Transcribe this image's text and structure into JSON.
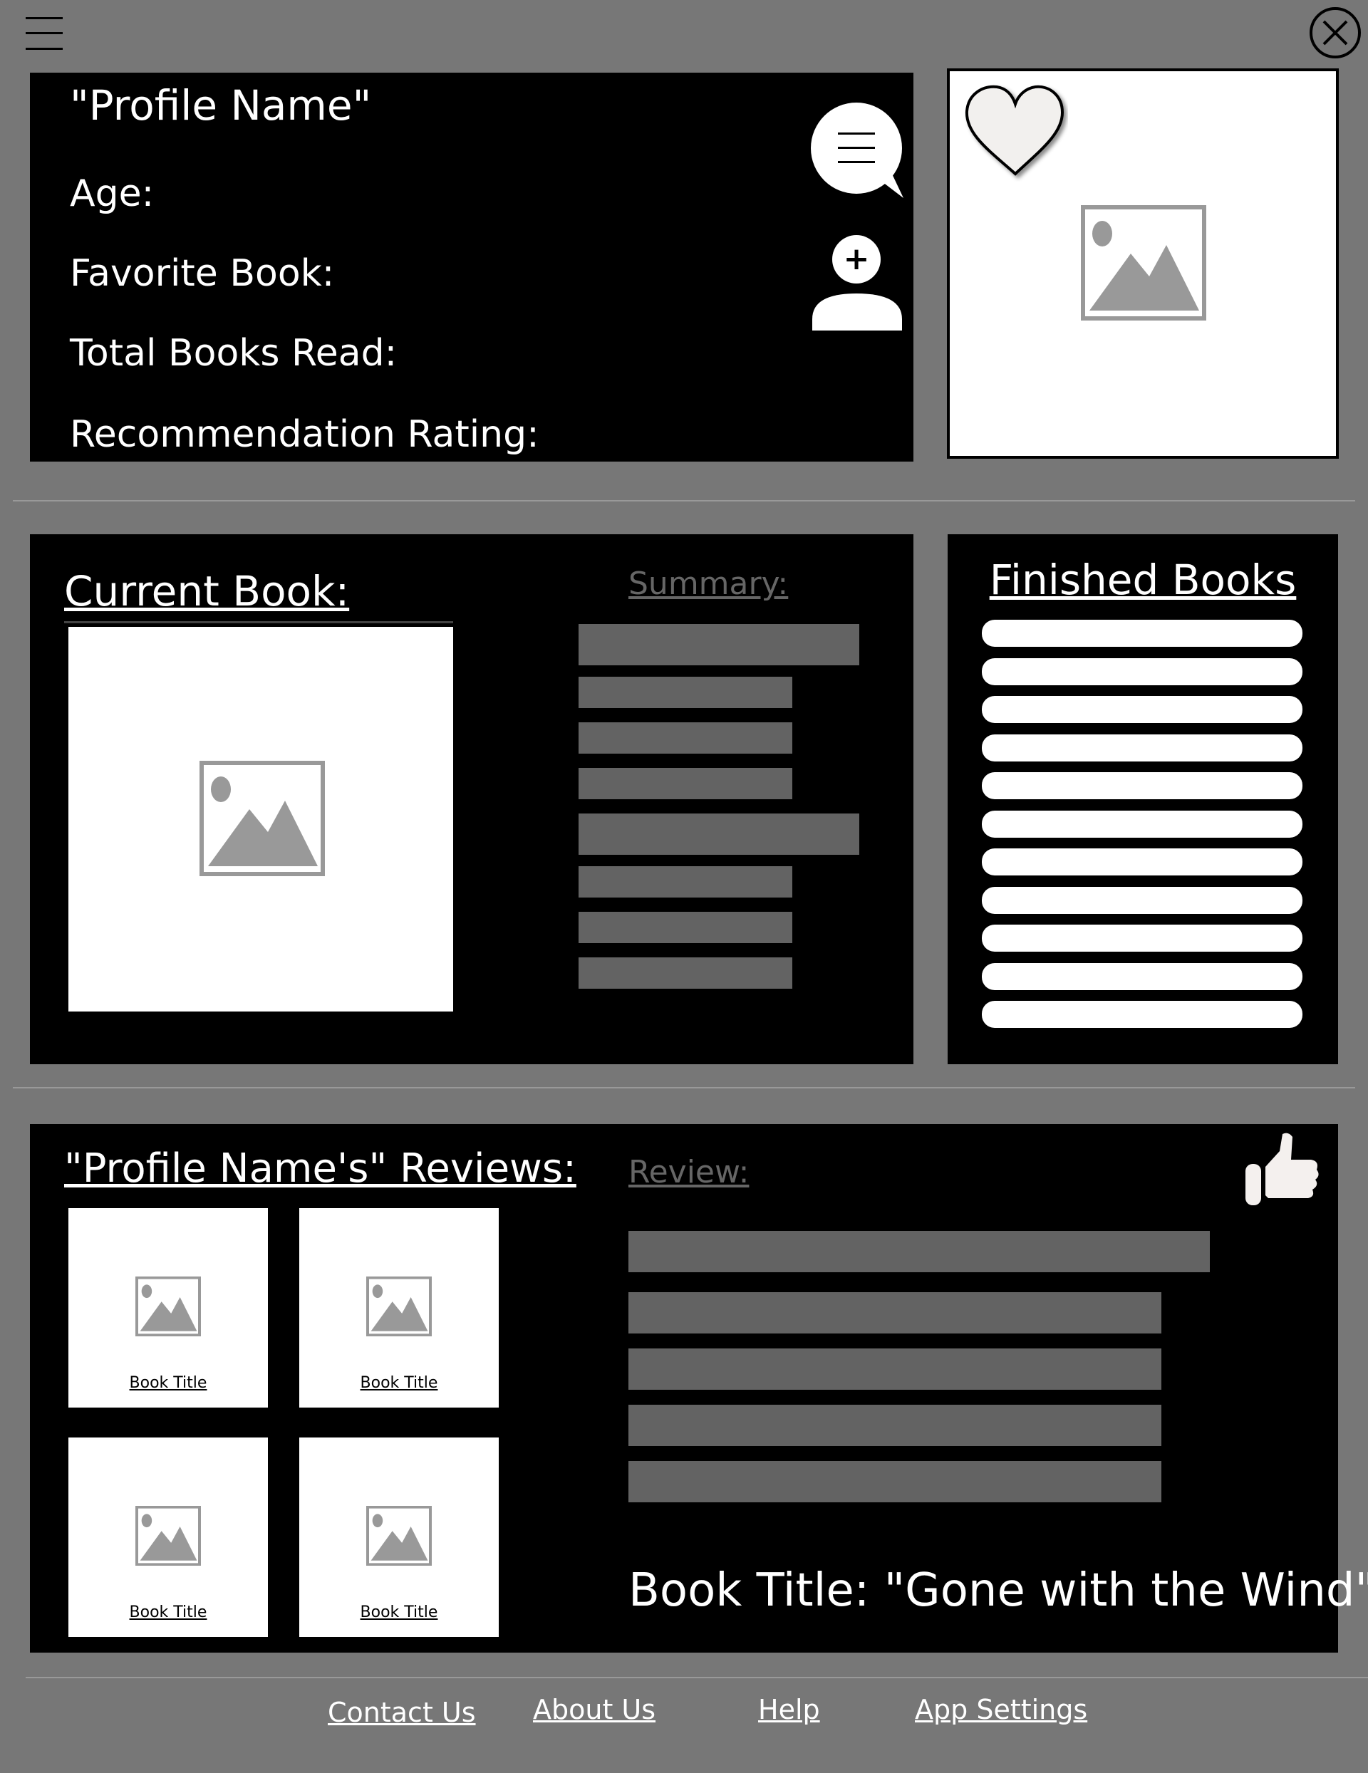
{
  "icons": {
    "menu": "hamburger-menu-icon",
    "close": "close-circle-icon",
    "chat": "chat-bubble-icon",
    "add_friend": "add-user-icon",
    "favorite": "heart-icon",
    "like": "thumbs-up-icon",
    "image": "image-placeholder-icon"
  },
  "profile": {
    "name": "\"Profile Name\"",
    "age_label": "Age:",
    "favorite_book_label": "Favorite Book:",
    "total_books_label": "Total Books Read:",
    "recommendation_label": "Recommendation Rating:"
  },
  "current": {
    "heading": "Current Book:",
    "summary_label": "Summary:"
  },
  "finished": {
    "heading": "Finished Books",
    "count": 11
  },
  "reviews": {
    "heading": "\"Profile Name's\" Reviews:",
    "review_label": "Review:",
    "tiles": [
      "Book Title",
      "Book Title",
      "Book Title",
      "Book Title"
    ],
    "book_title": "Book Title: \"Gone with the Wind\""
  },
  "footer": {
    "contact": "Contact Us",
    "about": "About Us",
    "help": "Help",
    "settings": "App Settings"
  },
  "colors": {
    "background": "#777777",
    "panel": "#000000",
    "placeholder_bar": "#636363",
    "placeholder_image": "#999999"
  }
}
